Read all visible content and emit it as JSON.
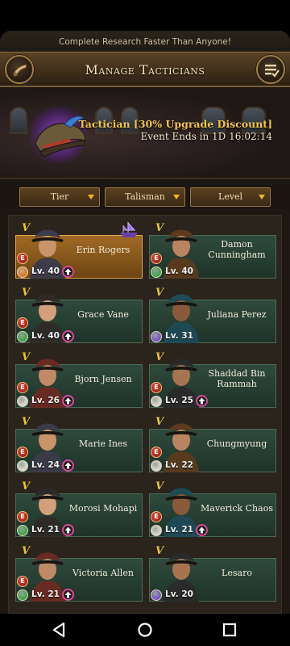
{
  "header": {
    "tagline": "Complete Research Faster Than Anyone!",
    "title": "Manage Tacticians",
    "back_icon": "horn-icon",
    "menu_icon": "checklist-icon"
  },
  "event": {
    "title": "Tactician [30% Upgrade Discount]",
    "timer": "Event Ends in 1D 16:02:14",
    "icon": "pirate-hat-icon"
  },
  "filters": [
    {
      "label": "Tier"
    },
    {
      "label": "Talisman"
    },
    {
      "label": "Level"
    }
  ],
  "tacticians": [
    {
      "name": "Erin Rogers",
      "level": "Lv. 40",
      "tier": "E",
      "talisman": "orange",
      "upgrade": true,
      "selected": true,
      "ship": true
    },
    {
      "name": "Damon Cunningham",
      "level": "Lv. 40",
      "tier": "E",
      "talisman": "green",
      "upgrade": false
    },
    {
      "name": "Grace Vane",
      "level": "Lv. 40",
      "tier": "E",
      "talisman": "green",
      "upgrade": true
    },
    {
      "name": "Juliana Perez",
      "level": "Lv. 31",
      "tier": "",
      "talisman": "purple",
      "upgrade": false
    },
    {
      "name": "Bjorn Jensen",
      "level": "Lv. 26",
      "tier": "E",
      "talisman": "white",
      "upgrade": true
    },
    {
      "name": "Shaddad Bin Rammah",
      "level": "Lv. 25",
      "tier": "E",
      "talisman": "white",
      "upgrade": true
    },
    {
      "name": "Marie Ines",
      "level": "Lv. 24",
      "tier": "E",
      "talisman": "white",
      "upgrade": true
    },
    {
      "name": "Chungmyung",
      "level": "Lv. 22",
      "tier": "E",
      "talisman": "white",
      "upgrade": false
    },
    {
      "name": "Morosi Mohapi",
      "level": "Lv. 21",
      "tier": "E",
      "talisman": "green",
      "upgrade": true
    },
    {
      "name": "Maverick Chaos",
      "level": "Lv. 21",
      "tier": "E",
      "talisman": "white",
      "upgrade": true
    },
    {
      "name": "Victoria Allen",
      "level": "Lv. 21",
      "tier": "E",
      "talisman": "green",
      "upgrade": true
    },
    {
      "name": "Lesaro",
      "level": "Lv. 20",
      "tier": "",
      "talisman": "purple",
      "upgrade": false
    }
  ],
  "colors": {
    "talisman_orange": "#e0792c",
    "talisman_green": "#3fa648",
    "talisman_purple": "#7b55c9",
    "talisman_white": "#d9d6cc",
    "selected_card": "#a06a24",
    "card": "#2f4a3c",
    "accent_gold": "#f2c74a"
  },
  "navigation": {
    "back_icon": "triangle-back-icon",
    "home_icon": "circle-home-icon",
    "recents_icon": "square-recents-icon"
  }
}
